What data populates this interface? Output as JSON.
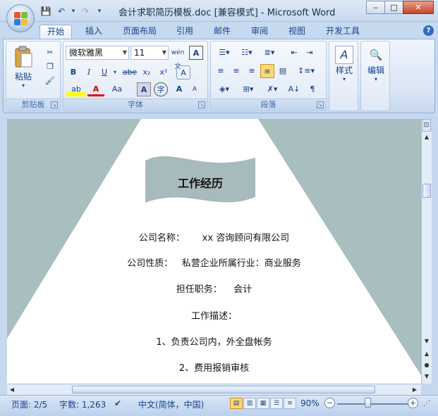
{
  "window": {
    "title": "会计求职简历模板.doc [兼容模式] - Microsoft Word",
    "minimize": "‒",
    "maximize": "□",
    "close": "✕"
  },
  "qat": {
    "save": "💾",
    "undo": "↶",
    "redo": "↷",
    "more": "▾"
  },
  "tabs": [
    "开始",
    "插入",
    "页面布局",
    "引用",
    "邮件",
    "审阅",
    "视图",
    "开发工具"
  ],
  "ribbon": {
    "clipboard": {
      "label": "剪贴板",
      "paste": "粘贴"
    },
    "font": {
      "label": "字体",
      "font_name": "微软雅黑",
      "font_size": "11",
      "bold": "B",
      "italic": "I",
      "underline": "U",
      "strike": "abe",
      "subscript": "x₂",
      "superscript": "x²",
      "clear": "A",
      "grow": "A",
      "shrink": "A",
      "case": "Aa",
      "wen": "wén 文"
    },
    "paragraph": {
      "label": "段落"
    },
    "styles": {
      "label": "样式"
    },
    "editing": {
      "label": "编辑"
    }
  },
  "document": {
    "section_title": "工作经历",
    "lines": [
      "公司名称：      xx 咨询顾问有限公司",
      "公司性质：   私营企业所属行业：商业服务",
      "担任职务：    会计",
      "工作描述：",
      "1、负责公司内，外全盘帐务",
      "2、费用报销审核"
    ]
  },
  "status": {
    "page": "页面: 2/5",
    "words": "字数: 1,263",
    "language": "中文(简体，中国)",
    "zoom": "90%"
  },
  "colors": {
    "accent": "#15428b",
    "page_bg": "#a8bebf",
    "banner": "#a7bbbd"
  }
}
